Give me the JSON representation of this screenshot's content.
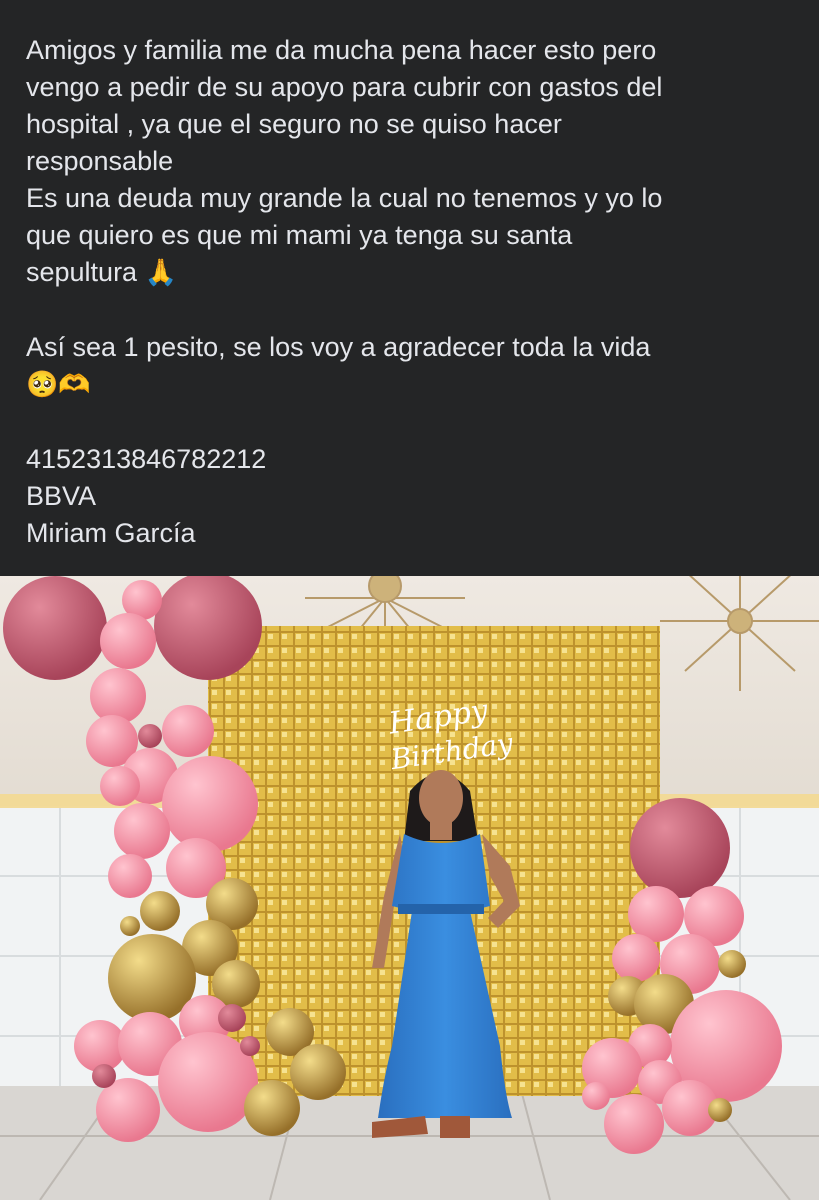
{
  "post": {
    "lines": [
      "Amigos  y familia me da mucha pena hacer esto pero",
      "vengo a pedir de su apoyo para cubrir con gastos del",
      "hospital , ya que el seguro no se quiso hacer",
      "responsable",
      "Es una deuda muy grande la cual no tenemos y yo lo",
      "que quiero es que mi mami ya tenga su santa",
      "sepultura",
      "",
      "Así sea 1 pesito, se los voy a agradecer toda la vida",
      "",
      "",
      "4152313846782212",
      "BBVA",
      "Miriam García"
    ],
    "emojis": {
      "praying_hands": "🙏",
      "pleading_face": "🥺",
      "heart_hands": "🫶"
    }
  },
  "photo": {
    "neon_sign_line1": "Happy",
    "neon_sign_line2": "Birthday",
    "colors": {
      "background": "#242526",
      "text": "#e4e6eb",
      "sequin_gold": "#c9a227",
      "balloon_rose": "#c25a6e",
      "balloon_pink": "#f08aa0",
      "balloon_gold": "#b8913a",
      "dress_blue": "#2f7fd0"
    }
  }
}
